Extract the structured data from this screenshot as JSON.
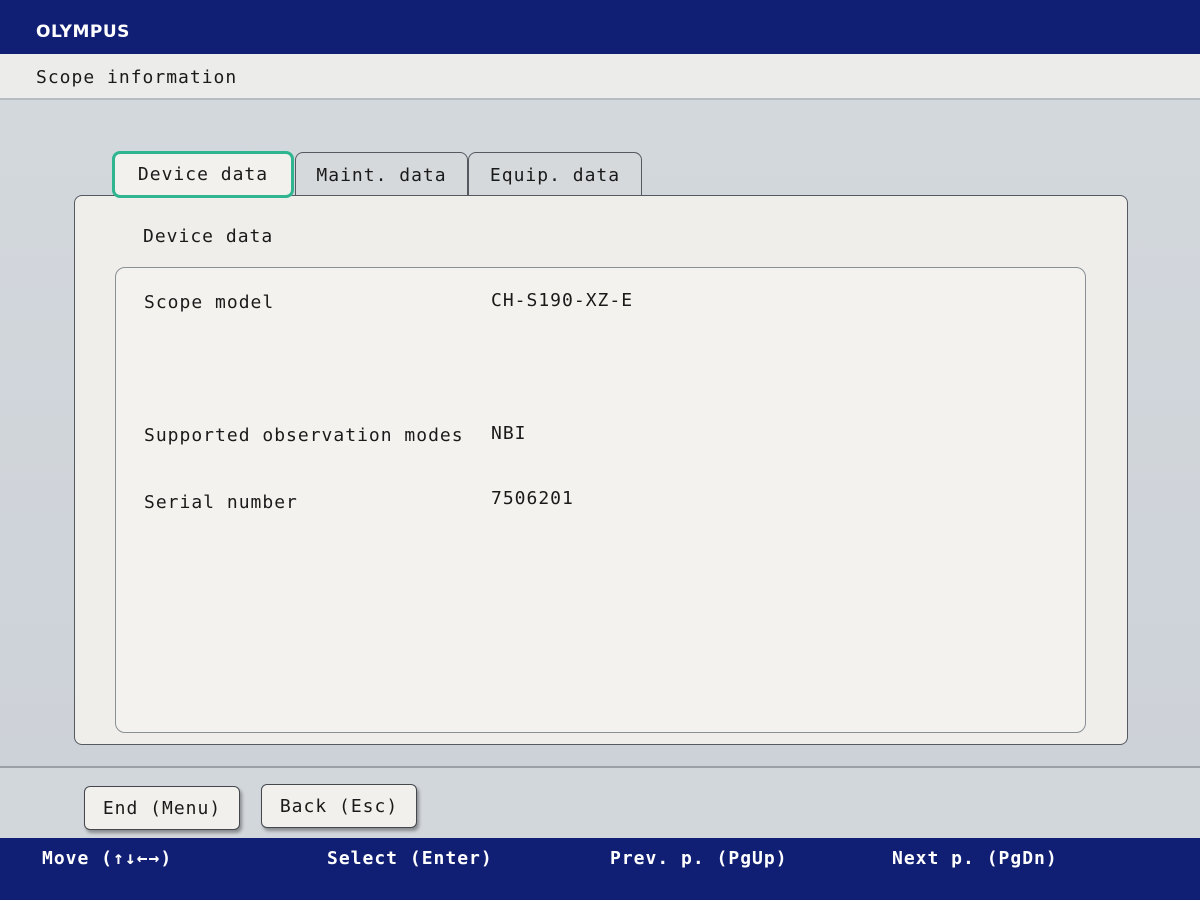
{
  "header": {
    "brand": "OLYMPUS",
    "page_title": "Scope information"
  },
  "tabs": [
    {
      "label": "Device data",
      "active": true
    },
    {
      "label": "Maint. data",
      "active": false
    },
    {
      "label": "Equip. data",
      "active": false
    }
  ],
  "panel": {
    "heading": "Device data",
    "fields": [
      {
        "label": "Scope model",
        "value": "CH-S190-XZ-E"
      },
      {
        "label": "Supported observation modes",
        "value": "NBI"
      },
      {
        "label": "Serial number",
        "value": "7506201"
      }
    ]
  },
  "buttons": {
    "end": "End (Menu)",
    "back": "Back (Esc)"
  },
  "hints": {
    "move": "Move (↑↓←→)",
    "select": "Select (Enter)",
    "prev": "Prev. p. (PgUp)",
    "next": "Next p. (PgDn)"
  },
  "colors": {
    "bar_blue": "#101f74",
    "active_tab_border": "#2fb58f"
  }
}
